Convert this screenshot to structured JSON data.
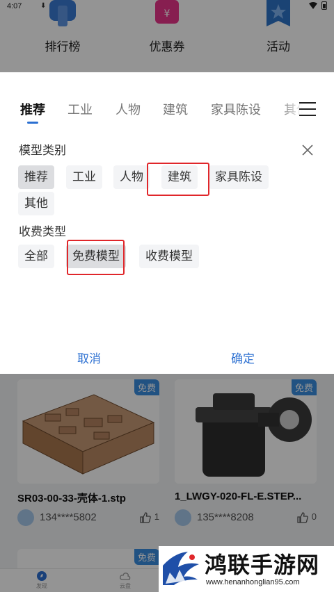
{
  "status_bar": {
    "time": "4:07"
  },
  "quick_actions": [
    {
      "label": "排行榜",
      "color": "#3a7bd5"
    },
    {
      "label": "优惠券",
      "color": "#e8358a"
    },
    {
      "label": "活动",
      "color": "#2e74c9"
    }
  ],
  "filter_sheet": {
    "category_tabs": [
      "推荐",
      "工业",
      "人物",
      "建筑",
      "家具陈设",
      "其他"
    ],
    "active_tab": "推荐",
    "model_category": {
      "title": "模型类别",
      "options": [
        "推荐",
        "工业",
        "人物",
        "建筑",
        "家具陈设",
        "其他"
      ],
      "selected": "推荐",
      "highlighted": "建筑"
    },
    "fee_type": {
      "title": "收费类型",
      "options": [
        "全部",
        "免费模型",
        "收费模型"
      ],
      "selected": "免费模型"
    },
    "cancel_label": "取消",
    "confirm_label": "确定",
    "accent_color": "#2b6fd1",
    "highlight_color": "#e0262a"
  },
  "model_cards": [
    {
      "tag": "免费",
      "title": "SR03-00-33-壳体-1.stp",
      "user": "134****5802",
      "likes": "1"
    },
    {
      "tag": "免费",
      "title": "1_LWGY-020-FL-E.STEP...",
      "user": "135****8208",
      "likes": "0"
    }
  ],
  "next_card": {
    "tag": "免费"
  },
  "bottom_tabs": [
    {
      "label": "发现",
      "icon": "compass-icon"
    },
    {
      "label": "云盘",
      "icon": "cloud-icon"
    }
  ],
  "watermark": {
    "title": "鸿联手游网",
    "url": "www.henanhonglian95.com"
  }
}
